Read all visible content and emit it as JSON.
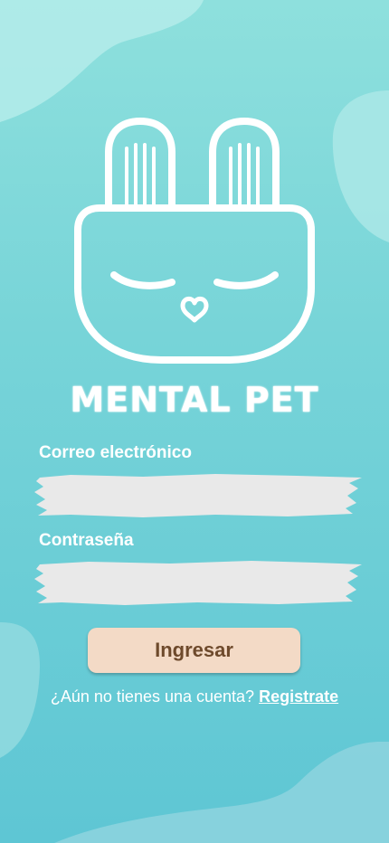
{
  "app": {
    "title": "MENTAL PET",
    "logo_icon": "bunny-face-icon"
  },
  "form": {
    "email_label": "Correo electrónico",
    "email_value": "",
    "password_label": "Contraseña",
    "password_value": "",
    "submit_label": "Ingresar"
  },
  "register": {
    "prompt": "¿Aún no tienes una cuenta?",
    "link_label": "Registrate"
  },
  "colors": {
    "background_top": "#8ee0dd",
    "background_bottom": "#5ec6d4",
    "field_fill": "#e9e9e9",
    "button_fill": "#f3dac6",
    "button_text": "#6e4a2c"
  }
}
